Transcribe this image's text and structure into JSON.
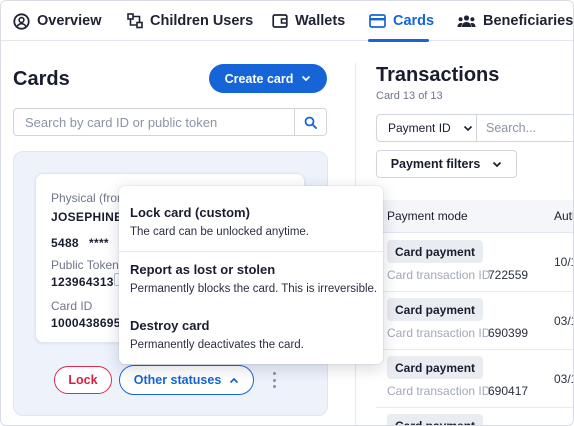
{
  "nav": {
    "tabs": [
      {
        "label": "Overview",
        "icon": "user-circle-icon"
      },
      {
        "label": "Children Users",
        "icon": "sitemap-icon"
      },
      {
        "label": "Wallets",
        "icon": "wallet-icon"
      },
      {
        "label": "Cards",
        "icon": "credit-card-icon",
        "active": true
      },
      {
        "label": "Beneficiaries",
        "icon": "users-group-icon"
      }
    ]
  },
  "cards": {
    "title": "Cards",
    "create_label": "Create card",
    "search_placeholder": "Search by card ID or public token",
    "card": {
      "type": "Physical (from",
      "holder": "JOSEPHINE",
      "number_first": "5488",
      "number_mask": "****",
      "public_token_label": "Public Token",
      "public_token": "123964313",
      "card_id_label": "Card ID",
      "card_id": "1000438695"
    },
    "lock_label": "Lock",
    "other_statuses_label": "Other statuses"
  },
  "menu": {
    "items": [
      {
        "title": "Lock card (custom)",
        "desc": "The card can be unlocked anytime."
      },
      {
        "title": "Report as lost or stolen",
        "desc": "Permanently blocks the card. This is irreversible."
      },
      {
        "title": "Destroy card",
        "desc": "Permanently deactivates the card."
      }
    ]
  },
  "transactions": {
    "title": "Transactions",
    "subtitle": "Card 13 of 13",
    "filter_select": "Payment ID",
    "filter_placeholder": "Search...",
    "payment_filters_label": "Payment filters",
    "columns": [
      "Payment mode",
      "Auth"
    ],
    "rows": [
      {
        "mode": "Card payment",
        "id_label": "Card transaction ID",
        "id": "722559",
        "date": "10/1"
      },
      {
        "mode": "Card payment",
        "id_label": "Card transaction ID",
        "id": "690399",
        "date": "03/1"
      },
      {
        "mode": "Card payment",
        "id_label": "Card transaction ID",
        "id": "690417",
        "date": "03/1"
      },
      {
        "mode": "Card payment",
        "id_label": "",
        "id": "",
        "date": ""
      }
    ]
  },
  "colors": {
    "accent": "#1565d8",
    "danger": "#d81f42"
  }
}
